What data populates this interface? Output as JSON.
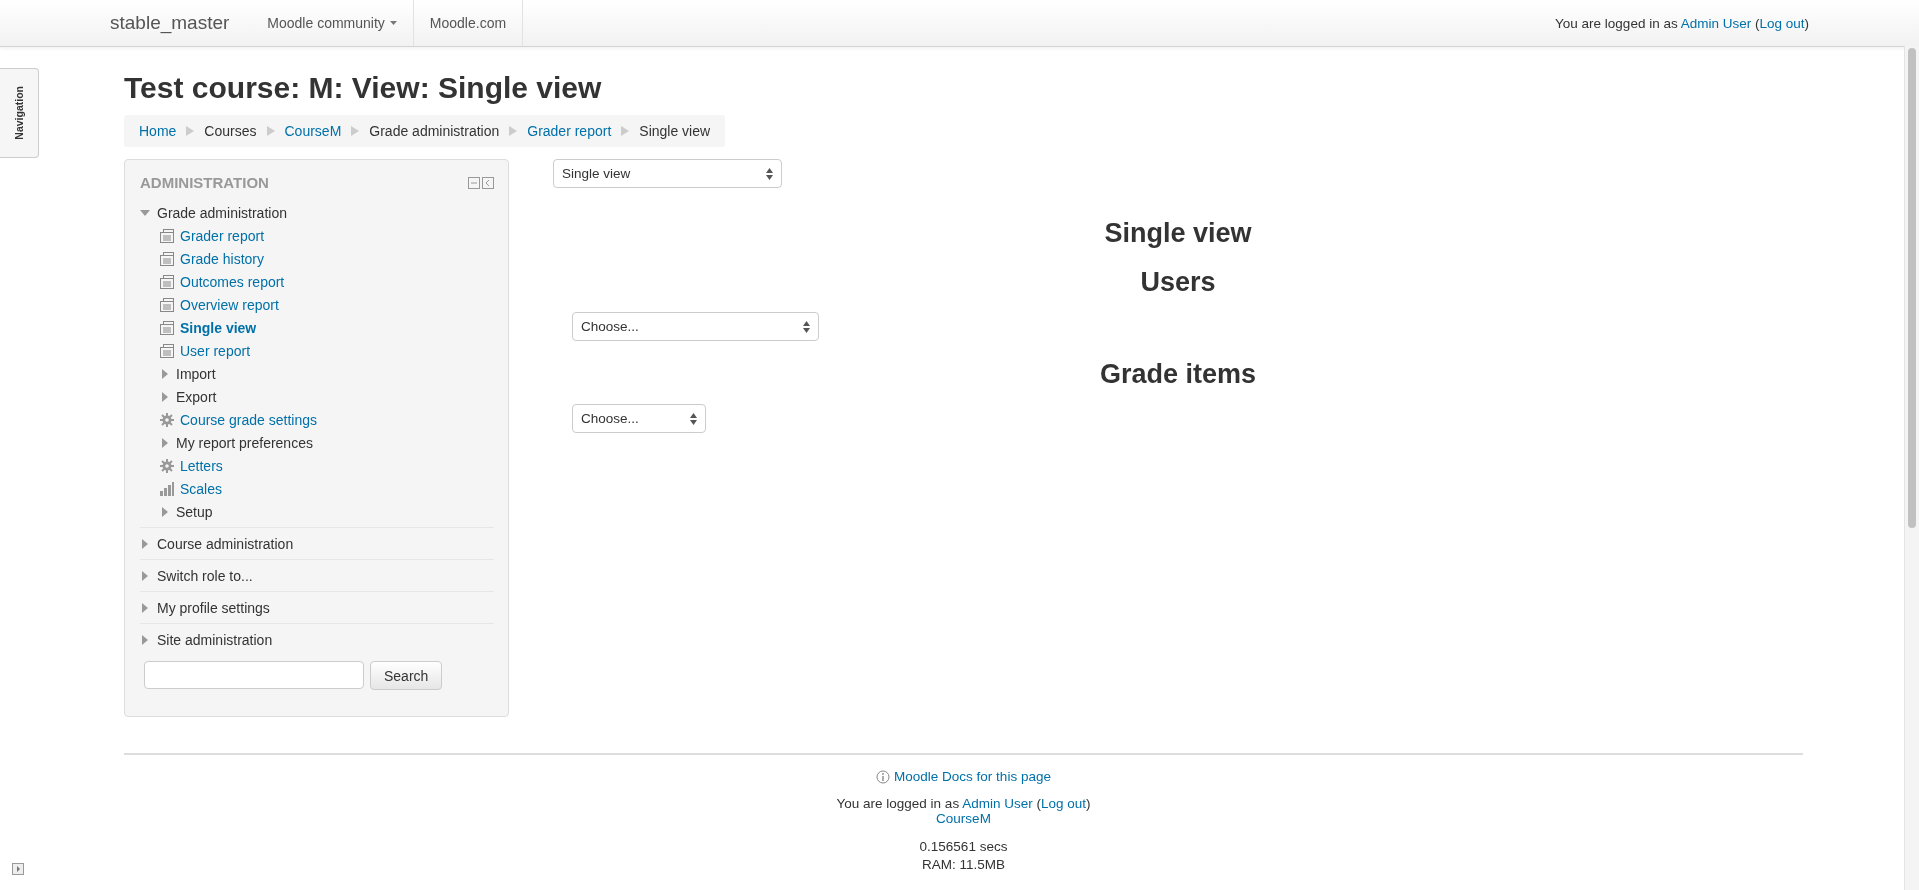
{
  "navbar": {
    "brand": "stable_master",
    "menu": [
      {
        "label": "Moodle community",
        "dropdown": true
      },
      {
        "label": "Moodle.com",
        "dropdown": false
      }
    ],
    "login": {
      "prefix": "You are logged in as ",
      "user": "Admin User",
      "open": " (",
      "logout": "Log out",
      "close": ")"
    }
  },
  "side_tab": {
    "label": "Navigation"
  },
  "page_title": "Test course: M: View: Single view",
  "breadcrumb": [
    {
      "label": "Home",
      "link": true
    },
    {
      "label": "Courses",
      "link": false
    },
    {
      "label": "CourseM",
      "link": true
    },
    {
      "label": "Grade administration",
      "link": false
    },
    {
      "label": "Grader report",
      "link": true
    },
    {
      "label": "Single view",
      "link": false
    }
  ],
  "admin_block": {
    "title": "ADMINISTRATION",
    "sections": [
      {
        "label": "Grade administration",
        "expanded": true,
        "children": [
          {
            "kind": "report",
            "label": "Grader report",
            "selected": false
          },
          {
            "kind": "report",
            "label": "Grade history",
            "selected": false
          },
          {
            "kind": "report",
            "label": "Outcomes report",
            "selected": false
          },
          {
            "kind": "report",
            "label": "Overview report",
            "selected": false
          },
          {
            "kind": "report",
            "label": "Single view",
            "selected": true
          },
          {
            "kind": "report",
            "label": "User report",
            "selected": false
          },
          {
            "kind": "branch",
            "label": "Import",
            "selected": false
          },
          {
            "kind": "branch",
            "label": "Export",
            "selected": false
          },
          {
            "kind": "settings",
            "label": "Course grade settings",
            "selected": false
          },
          {
            "kind": "branch",
            "label": "My report preferences",
            "selected": false
          },
          {
            "kind": "settings",
            "label": "Letters",
            "selected": false
          },
          {
            "kind": "scales",
            "label": "Scales",
            "selected": false
          },
          {
            "kind": "branch",
            "label": "Setup",
            "selected": false
          }
        ]
      },
      {
        "label": "Course administration",
        "expanded": false
      },
      {
        "label": "Switch role to...",
        "expanded": false
      },
      {
        "label": "My profile settings",
        "expanded": false
      },
      {
        "label": "Site administration",
        "expanded": false
      }
    ],
    "search_button": "Search"
  },
  "main": {
    "view_select": "Single view",
    "heading": "Single view",
    "groups": [
      {
        "heading": "Users",
        "select": "Choose...",
        "wide": true
      },
      {
        "heading": "Grade items",
        "select": "Choose...",
        "wide": false
      }
    ]
  },
  "footer": {
    "docs_link": "Moodle Docs for this page",
    "login": {
      "prefix": "You are logged in as ",
      "user": "Admin User",
      "open": " (",
      "logout": "Log out",
      "close": ")"
    },
    "course_link": "CourseM",
    "timing": "0.156561 secs",
    "ram": "RAM: 11.5MB"
  }
}
